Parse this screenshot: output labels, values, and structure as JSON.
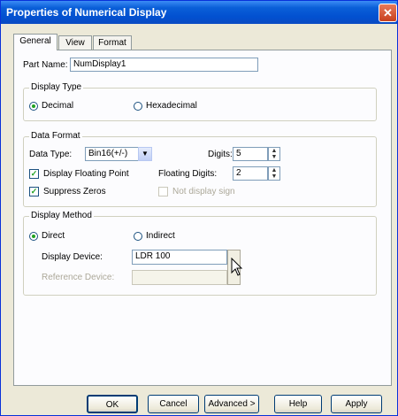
{
  "window": {
    "title": "Properties of Numerical Display",
    "close_label": "✕"
  },
  "tabs": [
    {
      "label": "General",
      "active": true
    },
    {
      "label": "View",
      "active": false
    },
    {
      "label": "Format",
      "active": false
    }
  ],
  "part_name": {
    "label": "Part Name:",
    "value": "NumDisplay1"
  },
  "display_type": {
    "legend": "Display Type",
    "decimal_label": "Decimal",
    "hexadecimal_label": "Hexadecimal",
    "selected": "Decimal"
  },
  "data_format": {
    "legend": "Data Format",
    "data_type_label": "Data Type:",
    "data_type_value": "Bin16(+/-)",
    "digits_label": "Digits:",
    "digits_value": "5",
    "display_floating_label": "Display Floating Point",
    "display_floating_checked": true,
    "floating_digits_label": "Floating Digits:",
    "floating_digits_value": "2",
    "suppress_zeros_label": "Suppress Zeros",
    "suppress_zeros_checked": true,
    "not_display_sign_label": "Not display sign",
    "not_display_sign_checked": false
  },
  "display_method": {
    "legend": "Display Method",
    "direct_label": "Direct",
    "indirect_label": "Indirect",
    "selected": "Direct",
    "display_device_label": "Display Device:",
    "display_device_value": "LDR 100",
    "reference_device_label": "Reference Device:",
    "reference_device_value": ""
  },
  "buttons": {
    "ok": "OK",
    "cancel": "Cancel",
    "advanced": "Advanced >",
    "help": "Help",
    "apply": "Apply"
  },
  "icons": {
    "close": "close-icon",
    "dropdown": "chevron-down-icon",
    "spin": "spin-arrows-icon",
    "cursor": "mouse-pointer-icon"
  }
}
